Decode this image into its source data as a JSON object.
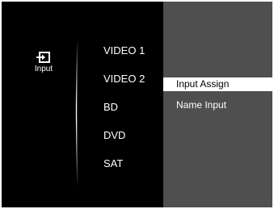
{
  "category": {
    "icon": "input-icon",
    "label": "Input"
  },
  "sources": [
    {
      "label": "VIDEO 1"
    },
    {
      "label": "VIDEO 2"
    },
    {
      "label": "BD"
    },
    {
      "label": "DVD"
    },
    {
      "label": "SAT"
    }
  ],
  "options_menu": {
    "items": [
      {
        "label": "Input Assign",
        "selected": true
      },
      {
        "label": "Name Input",
        "selected": false
      }
    ]
  },
  "colors": {
    "background": "#000000",
    "panel": "#4f4f4f",
    "highlight": "#ffffff",
    "text": "#ffffff",
    "highlight_text": "#000000"
  }
}
